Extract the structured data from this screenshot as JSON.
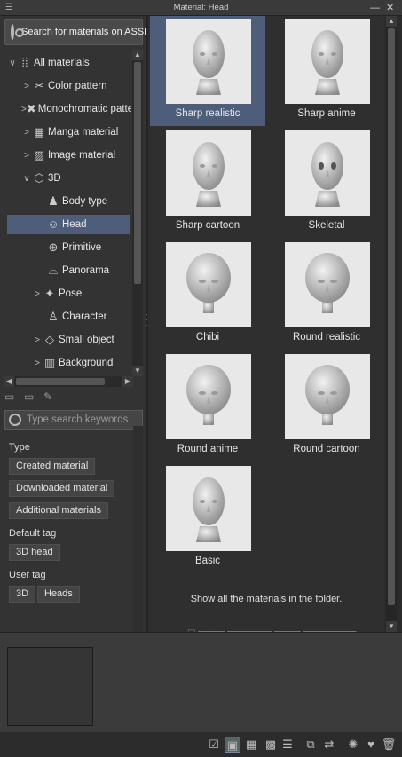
{
  "window": {
    "title": "Material: Head",
    "menu_glyph": "☰",
    "minimize_glyph": "—",
    "close_glyph": "✕"
  },
  "assets_button": {
    "label": "Search for materials on ASSETS"
  },
  "tree": {
    "items": [
      {
        "label": "All materials",
        "chevron": "∨",
        "icon": "grid-dots-icon",
        "glyph": "⁞⁞"
      },
      {
        "label": "Color pattern",
        "chevron": ">",
        "icon": "color-pattern-icon",
        "glyph": "✂"
      },
      {
        "label": "Monochromatic patte",
        "chevron": ">",
        "icon": "monochrome-pattern-icon",
        "glyph": "✖"
      },
      {
        "label": "Manga material",
        "chevron": ">",
        "icon": "manga-icon",
        "glyph": "▦"
      },
      {
        "label": "Image material",
        "chevron": ">",
        "icon": "image-icon",
        "glyph": "▨"
      },
      {
        "label": "3D",
        "chevron": "∨",
        "icon": "cube-icon",
        "glyph": "⬡"
      },
      {
        "label": "Body type",
        "chevron": "",
        "icon": "body-type-icon",
        "glyph": "♟"
      },
      {
        "label": "Head",
        "chevron": "",
        "icon": "head-icon",
        "glyph": "☺"
      },
      {
        "label": "Primitive",
        "chevron": "",
        "icon": "primitive-icon",
        "glyph": "⊕"
      },
      {
        "label": "Panorama",
        "chevron": "",
        "icon": "panorama-icon",
        "glyph": "⌓"
      },
      {
        "label": "Pose",
        "chevron": ">",
        "icon": "pose-icon",
        "glyph": "✦"
      },
      {
        "label": "Character",
        "chevron": "",
        "icon": "character-icon",
        "glyph": "♙"
      },
      {
        "label": "Small object",
        "chevron": ">",
        "icon": "small-object-icon",
        "glyph": "◇"
      },
      {
        "label": "Background",
        "chevron": ">",
        "icon": "background-icon",
        "glyph": "▥"
      }
    ],
    "selected": "Head"
  },
  "search": {
    "placeholder": "Type search keywords"
  },
  "filters": {
    "type_label": "Type",
    "type_tags": [
      "Created material",
      "Downloaded material",
      "Additional materials"
    ],
    "default_tag_label": "Default tag",
    "default_tags": [
      "3D head"
    ],
    "user_tag_label": "User tag",
    "user_tags": [
      "3D",
      "Heads"
    ]
  },
  "materials": [
    {
      "label": "Sharp realistic",
      "style": "sharp",
      "selected": true
    },
    {
      "label": "Sharp anime",
      "style": "sharp",
      "selected": false
    },
    {
      "label": "Sharp cartoon",
      "style": "sharp",
      "selected": false
    },
    {
      "label": "Skeletal",
      "style": "skull",
      "selected": false
    },
    {
      "label": "Chibi",
      "style": "round",
      "selected": false
    },
    {
      "label": "Round realistic",
      "style": "round",
      "selected": false
    },
    {
      "label": "Round anime",
      "style": "round",
      "selected": false
    },
    {
      "label": "Round cartoon",
      "style": "round",
      "selected": false
    },
    {
      "label": "Basic",
      "style": "sharp",
      "selected": false
    }
  ],
  "show_all_text": "Show all the materials in the folder.",
  "colors": {
    "selection": "#4e5d7a",
    "thumb_bg": "#e8e8e8",
    "head_fill": "#c9c9c9"
  }
}
